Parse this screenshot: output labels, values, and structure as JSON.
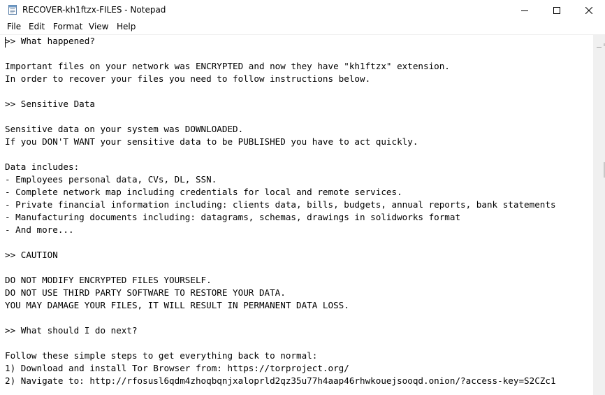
{
  "window": {
    "title": "RECOVER-kh1ftzx-FILES - Notepad"
  },
  "menu": {
    "items": [
      "File",
      "Edit",
      "Format",
      "View",
      "Help"
    ]
  },
  "document": {
    "lines": [
      ">> What happened?",
      "",
      "Important files on your network was ENCRYPTED and now they have \"kh1ftzx\" extension.",
      "In order to recover your files you need to follow instructions below.",
      "",
      ">> Sensitive Data",
      "",
      "Sensitive data on your system was DOWNLOADED.",
      "If you DON'T WANT your sensitive data to be PUBLISHED you have to act quickly.",
      "",
      "Data includes:",
      "- Employees personal data, CVs, DL, SSN.",
      "- Complete network map including credentials for local and remote services.",
      "- Private financial information including: clients data, bills, budgets, annual reports, bank statements",
      "- Manufacturing documents including: datagrams, schemas, drawings in solidworks format",
      "- And more...",
      "",
      ">> CAUTION",
      "",
      "DO NOT MODIFY ENCRYPTED FILES YOURSELF.",
      "DO NOT USE THIRD PARTY SOFTWARE TO RESTORE YOUR DATA.",
      "YOU MAY DAMAGE YOUR FILES, IT WILL RESULT IN PERMANENT DATA LOSS.",
      "",
      ">> What should I do next?",
      "",
      "Follow these simple steps to get everything back to normal:",
      "1) Download and install Tor Browser from: https://torproject.org/",
      "2) Navigate to: http://rfosusl6qdm4zhoqbqnjxaloprld2qz35u77h4aap46rhwkouejsooqd.onion/?access-key=S2CZc1"
    ]
  },
  "icons": {
    "app": "notepad-icon",
    "minimize": "minimize-icon",
    "maximize": "maximize-icon",
    "close": "close-icon"
  }
}
